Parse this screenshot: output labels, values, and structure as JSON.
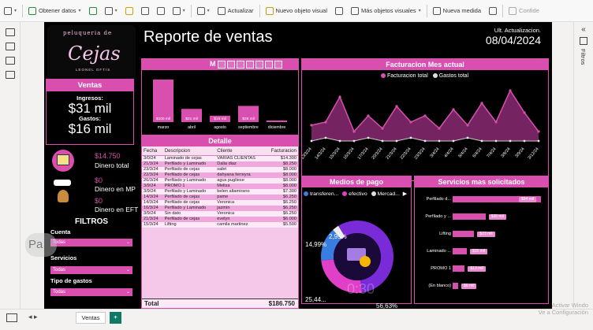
{
  "ribbon": {
    "items": [
      "Obtener datos",
      "Actualizar",
      "Nuevo objeto visual",
      "Más objetos visuales",
      "Nueva medida",
      "Confide"
    ]
  },
  "right_pane": {
    "collapse": "«",
    "label": "Filtros"
  },
  "report": {
    "logo_top": "peluqueria de",
    "logo_main": "Cejas",
    "logo_bottom": "LEONEL OFTIS",
    "title": "Reporte de ventas",
    "update_label": "Ult. Actualizacion.",
    "update_date": "08/04/2024"
  },
  "ventas": {
    "header": "Ventas",
    "ingresos_label": "Ingresos:",
    "ingresos_value": "$31 mil",
    "gastos_label": "Gastos:",
    "gastos_value": "$16 mil"
  },
  "kpis": [
    {
      "value": "$14.750",
      "label": "Dinero total"
    },
    {
      "value": "$0",
      "label": "Dinero en MP"
    },
    {
      "value": "$0",
      "label": "Dinero en EFT"
    }
  ],
  "filtros": {
    "title": "FILTROS",
    "cuenta_label": "Cuenta",
    "cuenta_value": "Todas",
    "servicios_label": "Servicios",
    "servicios_value": "Todas",
    "tipo_label": "Tipo de gastos",
    "tipo_value": "Todas"
  },
  "monthly_chart": {
    "header": "M",
    "chart_data": {
      "type": "bar",
      "categories": [
        "marzo",
        "abril",
        "agosto",
        "septiembre",
        "diciembre"
      ],
      "values": [
        100,
        31,
        15,
        38,
        3
      ],
      "labels": [
        "$100 mil",
        "$31 mil",
        "$15 mil",
        "$38 mil",
        ""
      ],
      "ylim": [
        0,
        100
      ]
    }
  },
  "detalle": {
    "header": "Detalle",
    "columns": [
      "Fecha",
      "Descripcion",
      "Cliente",
      "Facturacion"
    ],
    "rows": [
      [
        "3/0/24",
        "Laminado de cejas",
        "VARIAS CLIENTAS",
        "$14.300"
      ],
      [
        "21/3/24",
        "Perfilado y Laminado",
        "Dalia diaz",
        "$8.250"
      ],
      [
        "23/3/24",
        "Perfilado de cejas",
        "sabri",
        "$8.000"
      ],
      [
        "22/3/24",
        "Perfilado de cejas",
        "dahyana ferreyra",
        "$8.000"
      ],
      [
        "26/3/24",
        "Perfilado y Laminado",
        "agus pugliese",
        "$8.000"
      ],
      [
        "3/9/24",
        "PROMO 1",
        "Melisa",
        "$8.000"
      ],
      [
        "3/9/24",
        "Perfilado y Laminado",
        "belen altamirano",
        "$7.300"
      ],
      [
        "14/3/24",
        "Perfilado de cejas",
        "pame",
        "$6.250"
      ],
      [
        "14/3/24",
        "Perfilado de cejas",
        "Veronica",
        "$6.250"
      ],
      [
        "16/3/24",
        "Perfilado y Laminado",
        "jazmin",
        "$6.250"
      ],
      [
        "3/9/24",
        "Sin dato",
        "Veronica",
        "$6.250"
      ],
      [
        "21/3/24",
        "Perfilado de cejas",
        "evelyn",
        "$6.000"
      ],
      [
        "15/3/24",
        "Lifting",
        "camila martinez",
        "$5.500"
      ]
    ],
    "total_label": "Total",
    "total_value": "$186.750"
  },
  "facturacion": {
    "header": "Facturacion Mes actual",
    "legend": [
      "Facturacion total",
      "Gastos total"
    ],
    "chart_data": {
      "type": "line",
      "x": [
        "13/3/24",
        "14/3/24",
        "15/3/24",
        "16/3/24",
        "17/3/24",
        "20/3/24",
        "21/3/24",
        "22/3/24",
        "23/3/24",
        "3/4/24",
        "4/4/24",
        "5/4/24",
        "6/4/24",
        "7/4/24",
        "3/8/24",
        "3/9/24",
        "3/12/24"
      ],
      "series": [
        {
          "name": "Facturacion total",
          "values": [
            6,
            7,
            15,
            4,
            9,
            5,
            12,
            7,
            9,
            5,
            11,
            6,
            13,
            7,
            17,
            10,
            4
          ]
        },
        {
          "name": "Gastos total",
          "values": [
            1,
            2,
            1,
            1,
            2,
            1,
            1,
            2,
            1,
            1,
            1,
            2,
            1,
            1,
            1,
            1,
            1
          ]
        }
      ]
    }
  },
  "medios": {
    "header": "Medios de pago",
    "legend": [
      "transferen...",
      "efectivo",
      "Mercad..."
    ],
    "chart_data": {
      "type": "pie",
      "categories": [
        "transferencia",
        "efectivo",
        "Mercado"
      ],
      "values": [
        56.63,
        25.44,
        14.99,
        2.95
      ],
      "labels": [
        "56,63%",
        "25,44...",
        "14,99%",
        "2,95%"
      ]
    }
  },
  "servicios": {
    "header": "Servicios mas solicitados",
    "chart_data": {
      "type": "bar",
      "categories": [
        "Perfilado d...",
        "Perfilado y ...",
        "Lifting",
        "Laminado ...",
        "PROMO 1",
        "(En blanco)"
      ],
      "values": [
        94,
        35,
        23,
        15,
        13,
        6
      ],
      "labels": [
        "$94 mil",
        "$35 mil",
        "$23 mil",
        "$15 mil",
        "$13 mil",
        "$6 mil"
      ]
    }
  },
  "bottom": {
    "tab": "Ventas",
    "add": "+",
    "watermark_1": "Activar Windo",
    "watermark_2": "Ve a Configuración"
  },
  "overlay": {
    "time": "0:30",
    "left": "Pa"
  }
}
